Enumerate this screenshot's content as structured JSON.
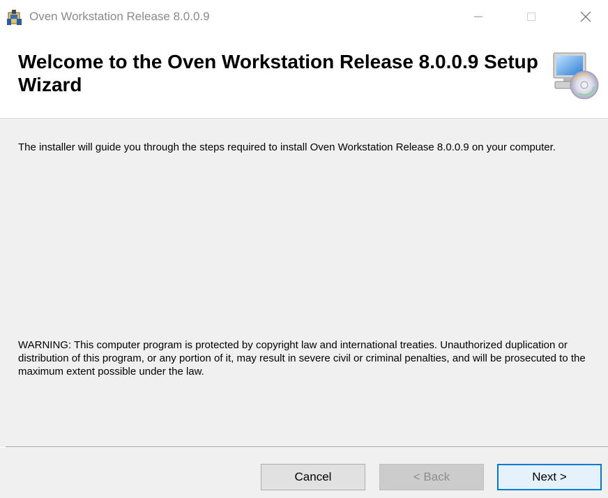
{
  "window": {
    "title": "Oven Workstation Release 8.0.0.9",
    "controls": {
      "minimize_icon": "minimize-icon",
      "maximize_icon": "maximize-icon",
      "close_icon": "close-icon"
    }
  },
  "banner": {
    "title": "Welcome to the Oven Workstation Release 8.0.0.9 Setup Wizard",
    "icon": "computer-disc-icon"
  },
  "content": {
    "intro": "The installer will guide you through the steps required to install Oven Workstation Release 8.0.0.9 on your computer.",
    "warning": "WARNING: This computer program is protected by copyright law and international treaties. Unauthorized duplication or distribution of this program, or any portion of it, may result in severe civil or criminal penalties, and will be prosecuted to the maximum extent possible under the law."
  },
  "buttons": {
    "cancel": "Cancel",
    "back": "< Back",
    "next": "Next >"
  },
  "colors": {
    "accent": "#0078d7",
    "body_background": "#f0f0f0",
    "disabled_text": "#8d8d8d"
  }
}
